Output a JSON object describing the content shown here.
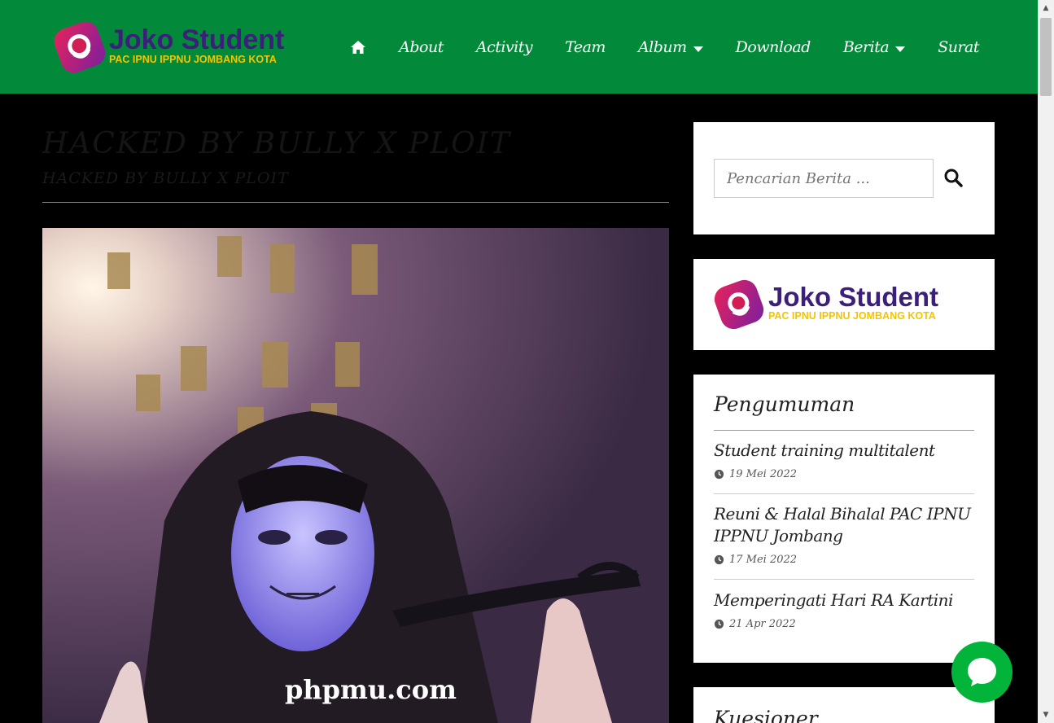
{
  "brand": {
    "name": "Joko Student",
    "tagline": "PAC IPNU IPPNU JOMBANG KOTA",
    "colors": {
      "header": "#028a3a",
      "primary_text": "#3b1f7a",
      "accent": "#f5c400"
    }
  },
  "nav": {
    "home_icon": "home-icon",
    "items": [
      {
        "label": "About",
        "has_dropdown": false
      },
      {
        "label": "Activity",
        "has_dropdown": false
      },
      {
        "label": "Team",
        "has_dropdown": false
      },
      {
        "label": "Album",
        "has_dropdown": true
      },
      {
        "label": "Download",
        "has_dropdown": false
      },
      {
        "label": "Berita",
        "has_dropdown": true
      },
      {
        "label": "Surat",
        "has_dropdown": false
      }
    ]
  },
  "article": {
    "title": "HACKED BY BULLY X PLOIT",
    "subtitle": "HACKED BY BULLY X PLOIT",
    "image_caption": "phpmu.com"
  },
  "sidebar": {
    "search": {
      "placeholder": "Pencarian Berita ...",
      "icon": "search-icon"
    },
    "announcements": {
      "heading": "Pengumuman",
      "posts": [
        {
          "title": "Student training multitalent",
          "date": "19 Mei 2022"
        },
        {
          "title": "Reuni & Halal Bihalal PAC IPNU IPPNU Jombang",
          "date": "17 Mei 2022"
        },
        {
          "title": "Memperingati Hari RA Kartini",
          "date": "21 Apr 2022"
        }
      ]
    },
    "kuesioner": {
      "heading": "Kuesioner"
    }
  },
  "chat": {
    "icon": "chat-bubble-icon"
  }
}
